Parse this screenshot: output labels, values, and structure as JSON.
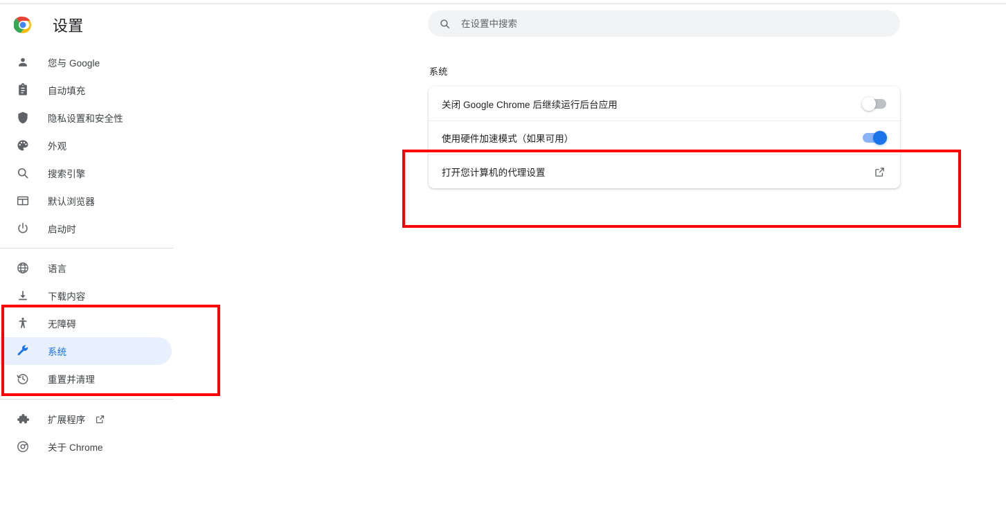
{
  "window": {
    "app_title": "设置",
    "logo_icon": "chrome-logo-icon"
  },
  "search": {
    "placeholder": "在设置中搜索",
    "value": "",
    "icon": "search-icon"
  },
  "sidebar": {
    "groups": [
      {
        "items": [
          {
            "label": "您与 Google",
            "icon": "person-icon",
            "selected": false
          },
          {
            "label": "自动填充",
            "icon": "clipboard-icon",
            "selected": false
          },
          {
            "label": "隐私设置和安全性",
            "icon": "shield-icon",
            "selected": false
          },
          {
            "label": "外观",
            "icon": "palette-icon",
            "selected": false
          },
          {
            "label": "搜索引擎",
            "icon": "search-icon",
            "selected": false
          },
          {
            "label": "默认浏览器",
            "icon": "browser-window-icon",
            "selected": false
          },
          {
            "label": "启动时",
            "icon": "power-icon",
            "selected": false
          }
        ]
      },
      {
        "items": [
          {
            "label": "语言",
            "icon": "globe-icon",
            "selected": false
          },
          {
            "label": "下载内容",
            "icon": "download-icon",
            "selected": false
          },
          {
            "label": "无障碍",
            "icon": "accessibility-icon",
            "selected": false
          },
          {
            "label": "系统",
            "icon": "wrench-icon",
            "selected": true
          },
          {
            "label": "重置并清理",
            "icon": "history-restore-icon",
            "selected": false
          }
        ]
      },
      {
        "items": [
          {
            "label": "扩展程序",
            "icon": "puzzle-piece-icon",
            "selected": false,
            "external": true
          },
          {
            "label": "关于 Chrome",
            "icon": "chrome-outline-icon",
            "selected": false
          }
        ]
      }
    ]
  },
  "main": {
    "section_title": "系统",
    "rows": [
      {
        "label": "关闭 Google Chrome 后继续运行后台应用",
        "control": "toggle",
        "state": "off"
      },
      {
        "label": "使用硬件加速模式（如果可用）",
        "control": "toggle",
        "state": "on"
      },
      {
        "label": "打开您计算机的代理设置",
        "control": "external-link",
        "icon": "open-in-new-icon"
      }
    ]
  },
  "annotations": [
    {
      "name": "sidebar-highlight",
      "color": "#ff0000"
    },
    {
      "name": "proxy-settings-highlight",
      "color": "#ff0000"
    }
  ],
  "colors": {
    "accent_blue": "#1a73e8",
    "selected_pill_bg": "#e8f0fe",
    "toggle_on_track": "#8ab4f8",
    "toggle_off_track": "#bdc1c6",
    "annotation_red": "#ff0000",
    "search_bg": "#f1f3f4",
    "icon_gray": "#5f6368"
  }
}
